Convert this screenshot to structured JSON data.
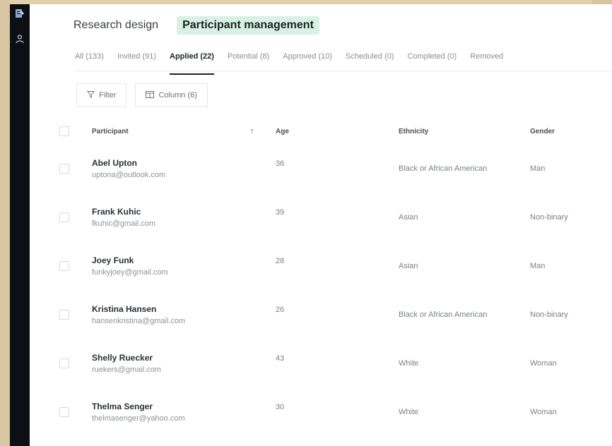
{
  "top_nav": {
    "research": "Research design",
    "participants": "Participant management"
  },
  "tabs": [
    {
      "label": "All (133)"
    },
    {
      "label": "Invited (91)"
    },
    {
      "label": "Applied (22)",
      "active": true
    },
    {
      "label": "Potential (8)"
    },
    {
      "label": "Approved (10)"
    },
    {
      "label": "Scheduled (0)"
    },
    {
      "label": "Completed (0)"
    },
    {
      "label": "Removed"
    }
  ],
  "toolbar": {
    "filter": "Filter",
    "column": "Column (6)"
  },
  "table": {
    "headers": {
      "participant": "Participant",
      "age": "Age",
      "ethnicity": "Ethnicity",
      "gender": "Gender"
    },
    "rows": [
      {
        "name": "Abel Upton",
        "email": "uptona@outlook.com",
        "age": "36",
        "ethnicity": "Black or African American",
        "gender": "Man"
      },
      {
        "name": "Frank Kuhic",
        "email": "fkuhic@gmail.com",
        "age": "39",
        "ethnicity": "Asian",
        "gender": "Non-binary"
      },
      {
        "name": "Joey Funk",
        "email": "funkyjoey@gmail.com",
        "age": "28",
        "ethnicity": "Asian",
        "gender": "Man"
      },
      {
        "name": "Kristina Hansen",
        "email": "hansenkristina@gmail.com",
        "age": "26",
        "ethnicity": "Black or African American",
        "gender": "Non-binary"
      },
      {
        "name": "Shelly Ruecker",
        "email": "ruekers@gmail.com",
        "age": "43",
        "ethnicity": "White",
        "gender": "Woman"
      },
      {
        "name": "Thelma Senger",
        "email": "thelmasenger@yahoo.com",
        "age": "30",
        "ethnicity": "White",
        "gender": "Woman"
      }
    ]
  },
  "colors": {
    "accent": "#d8f1e4",
    "rail": "#0c0f14",
    "backdrop": "#dcc8a6"
  },
  "icons": {
    "rail_top": "document-edit-icon",
    "rail_user": "user-icon",
    "filter": "filter-icon",
    "column": "columns-icon",
    "sort": "arrow-up-icon"
  }
}
